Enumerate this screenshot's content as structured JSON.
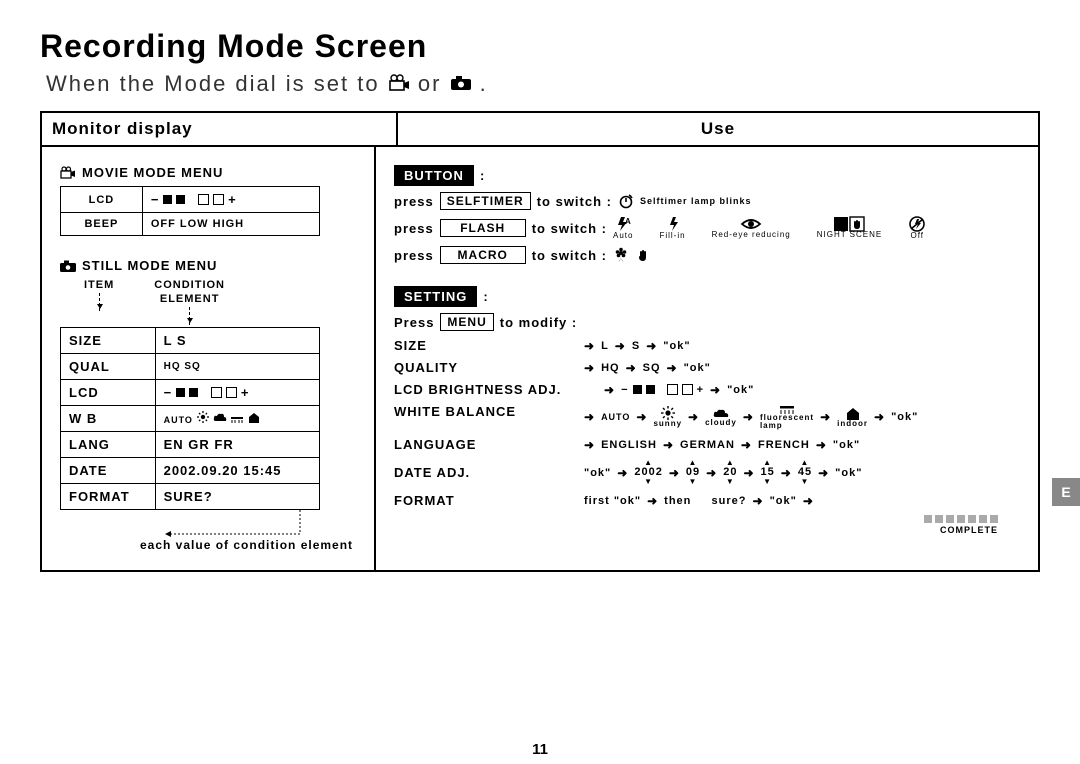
{
  "title": "Recording Mode Screen",
  "subtitle_pre": "When  the  Mode  dial  is  set  to",
  "subtitle_post": "or",
  "header": {
    "col1": "Monitor display",
    "col2": "Use"
  },
  "movie_menu_title": "MOVIE   MODE   MENU",
  "movie_menu": {
    "r1c1": "LCD",
    "r2c1": "BEEP",
    "r2c2": "OFF  LOW  HIGH"
  },
  "still_menu_title": "STILL  MODE  MENU",
  "colheads": {
    "c1": "ITEM",
    "c2": "CONDITION",
    "c2b": "ELEMENT"
  },
  "still_menu": [
    {
      "a": "SIZE",
      "b": "L         S"
    },
    {
      "a": "QUAL",
      "b": "HQ          SQ"
    },
    {
      "a": "LCD",
      "b": ""
    },
    {
      "a": "W  B",
      "b": ""
    },
    {
      "a": "LANG",
      "b": "EN  GR  FR"
    },
    {
      "a": "DATE",
      "b": "2002.09.20 15:45"
    },
    {
      "a": "FORMAT",
      "b": "SURE?"
    }
  ],
  "footnote": "each  value of condition element",
  "button_label": "BUTTON",
  "setting_label": "SETTING",
  "press": "press",
  "Press": "Press",
  "to_switch": "to  switch  :",
  "to_modify": "to  modify  :",
  "btn_selftimer": "SELFTIMER",
  "btn_flash": "FLASH",
  "btn_macro": "MACRO",
  "btn_menu": "MENU",
  "selftimer_note": "Selftimer  lamp  blinks",
  "flash_labels": {
    "auto": "Auto",
    "fill": "Fill-in",
    "red": "Red-eye reducing",
    "night": "NIGHT SCENE",
    "off": "Off"
  },
  "settings": {
    "size": {
      "label": "SIZE",
      "opts": [
        "L",
        "S",
        "\"ok\""
      ]
    },
    "quality": {
      "label": "QUALITY",
      "opts": [
        "HQ",
        "SQ",
        "\"ok\""
      ]
    },
    "lcd": {
      "label": "LCD  BRIGHTNESS  ADJ.",
      "tail": "\"ok\""
    },
    "wb": {
      "label": "WHITE  BALANCE",
      "auto": "AUTO",
      "sunny": "sunny",
      "cloudy": "cloudy",
      "fluor": "fluorescent",
      "fluor2": "lamp",
      "indoor": "indoor",
      "tail": "\"ok\""
    },
    "lang": {
      "label": "LANGUAGE",
      "opts": [
        "ENGLISH",
        "GERMAN",
        "FRENCH",
        "\"ok\""
      ]
    },
    "date": {
      "label": "DATE  ADJ.",
      "seq": [
        "\"ok\"",
        "2002",
        "09",
        "20",
        "15",
        "45",
        "\"ok\""
      ]
    },
    "format": {
      "label": "FORMAT",
      "first": "first \"ok\"",
      "then": "then",
      "sure": "sure?",
      "ok": "\"ok\"",
      "complete": "COMPLETE"
    }
  },
  "page_number": "11",
  "side_tab": "E"
}
